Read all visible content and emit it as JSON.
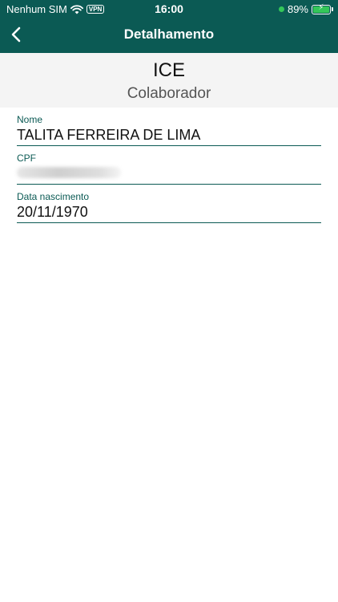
{
  "status_bar": {
    "carrier": "Nenhum SIM",
    "vpn": "VPN",
    "time": "16:00",
    "battery": "89%",
    "battery_level": 0.89
  },
  "nav": {
    "title": "Detalhamento",
    "back_icon": "chevron-left-icon"
  },
  "header": {
    "company": "ICE",
    "role": "Colaborador"
  },
  "fields": [
    {
      "label": "Nome",
      "value": "TALITA FERREIRA DE LIMA"
    },
    {
      "label": "CPF",
      "value": ""
    },
    {
      "label": "Data nascimento",
      "value": "20/11/1970"
    }
  ],
  "colors": {
    "primary": "#0b5a54",
    "header_bg": "#f4f4f4",
    "battery_green": "#34c759"
  }
}
